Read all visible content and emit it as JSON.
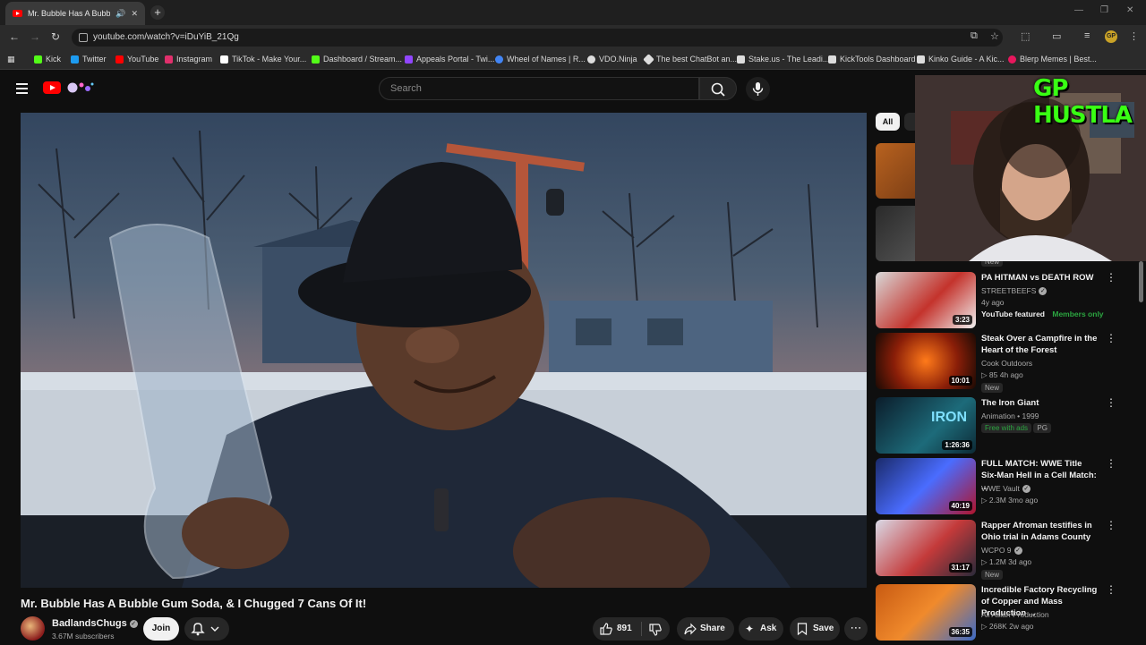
{
  "browser": {
    "tab_title": "Mr. Bubble Has A Bubble Gum Soda, & I Chugged 7 Cans Of It!",
    "url": "youtube.com/watch?v=iDuYiB_21Qg",
    "profile_initials": "GP",
    "bookmarks": [
      {
        "label": "Kick",
        "color": "#53fc18"
      },
      {
        "label": "Twitter",
        "color": "#1d9bf0"
      },
      {
        "label": "YouTube",
        "color": "#ff0000"
      },
      {
        "label": "Instagram",
        "color": "#e1306c"
      },
      {
        "label": "TikTok - Make Your...",
        "color": "#ffffff"
      },
      {
        "label": "Dashboard / Stream...",
        "color": "#53fc18"
      },
      {
        "label": "Appeals Portal - Twi...",
        "color": "#9146ff"
      },
      {
        "label": "Wheel of Names | R...",
        "color": "#4285f4"
      },
      {
        "label": "VDO.Ninja",
        "color": "#dddddd"
      },
      {
        "label": "The best ChatBot an...",
        "color": "#dddddd"
      },
      {
        "label": "Stake.us - The Leadi...",
        "color": "#dddddd"
      },
      {
        "label": "KickTools Dashboard",
        "color": "#dddddd"
      },
      {
        "label": "Kinko Guide - A Kic...",
        "color": "#dddddd"
      },
      {
        "label": "Blerp Memes | Best...",
        "color": "#e8175d"
      }
    ]
  },
  "header": {
    "search_placeholder": "Search"
  },
  "video": {
    "title": "Mr. Bubble Has A Bubble Gum Soda, & I Chugged 7 Cans Of It!",
    "channel": "BadlandsChugs",
    "subscribers": "3.67M subscribers",
    "join_label": "Join",
    "likes": "891",
    "share_label": "Share",
    "ask_label": "Ask",
    "save_label": "Save"
  },
  "sidebar": {
    "chip_all": "All",
    "partial_badge": "New",
    "items": [
      {
        "title": "PA HITMAN vs DEATH ROW",
        "channel": "STREETBEEFS",
        "meta": "4y ago",
        "duration": "3:23",
        "badge": "YouTube featured",
        "badge2": "Members only"
      },
      {
        "title": "Steak Over a Campfire in the Heart of the Forest",
        "channel": "Cook Outdoors",
        "meta": "85  4h ago",
        "duration": "10:01",
        "badge": "New"
      },
      {
        "title": "The Iron Giant",
        "channel": "Animation • 1999",
        "meta": "",
        "duration": "1:26:36",
        "badge": "Free with ads",
        "badge2": "PG"
      },
      {
        "title": "FULL MATCH: WWE Title Six-Man Hell in a Cell Match: ...",
        "channel": "WWE Vault",
        "meta": "2.3M  3mo ago",
        "duration": "40:19"
      },
      {
        "title": "Rapper Afroman testifies in Ohio trial in Adams County",
        "channel": "WCPO 9",
        "meta": "1.2M  3d ago",
        "duration": "31:17",
        "badge": "New"
      },
      {
        "title": "Incredible Factory Recycling of Copper and Mass Production ...",
        "channel": "All Asian Production",
        "meta": "268K  2w ago",
        "duration": "36:35"
      }
    ]
  },
  "overlay": {
    "text": "GP HUSTLA"
  }
}
